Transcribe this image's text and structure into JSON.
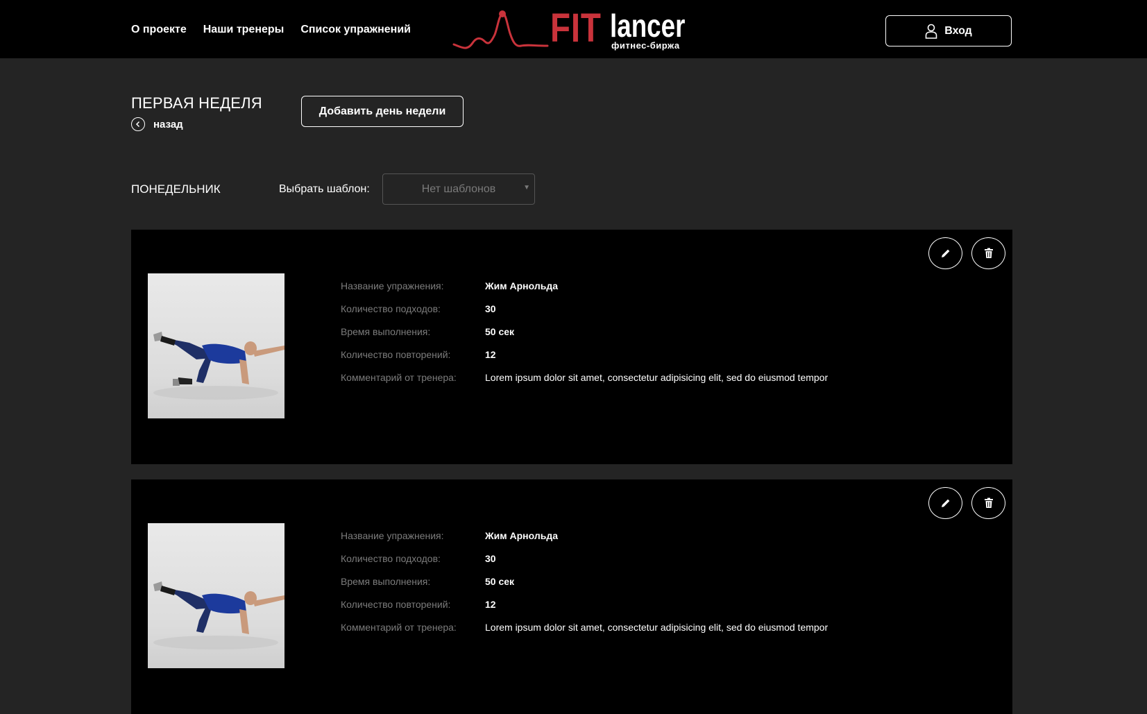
{
  "header": {
    "nav": [
      {
        "label": "О проекте"
      },
      {
        "label": "Наши тренеры"
      },
      {
        "label": "Список упражнений"
      }
    ],
    "logo": {
      "fit": "FIT",
      "lancer": "lancer",
      "subtitle": "фитнес-биржа"
    },
    "login_label": "Вход"
  },
  "page": {
    "title": "ПЕРВАЯ НЕДЕЛЯ",
    "back_label": "назад",
    "add_day_label": "Добавить день недели"
  },
  "day": {
    "title": "ПОНЕДЕЛЬНИК",
    "template_label": "Выбрать шаблон:",
    "template_value": "Нет шаблонов"
  },
  "labels": {
    "name": "Название упражнения:",
    "sets": "Количество подходов:",
    "time": "Время выполнения:",
    "reps": "Количество повторений:",
    "comment": "Комментарий от тренера:"
  },
  "exercises": [
    {
      "name": "Жим Арнольда",
      "sets": "30",
      "time": "50 сек",
      "reps": "12",
      "comment": "Lorem ipsum dolor sit amet, consectetur adipisicing elit, sed do eiusmod tempor"
    },
    {
      "name": "Жим Арнольда",
      "sets": "30",
      "time": "50 сек",
      "reps": "12",
      "comment": "Lorem ipsum dolor sit amet, consectetur adipisicing elit, sed do eiusmod tempor"
    }
  ],
  "colors": {
    "accent": "#c9333b",
    "background": "#242424",
    "card": "#000000"
  },
  "icons": [
    "user-icon",
    "back-arrow-icon",
    "pencil-icon",
    "trash-icon",
    "chevron-down-icon"
  ]
}
